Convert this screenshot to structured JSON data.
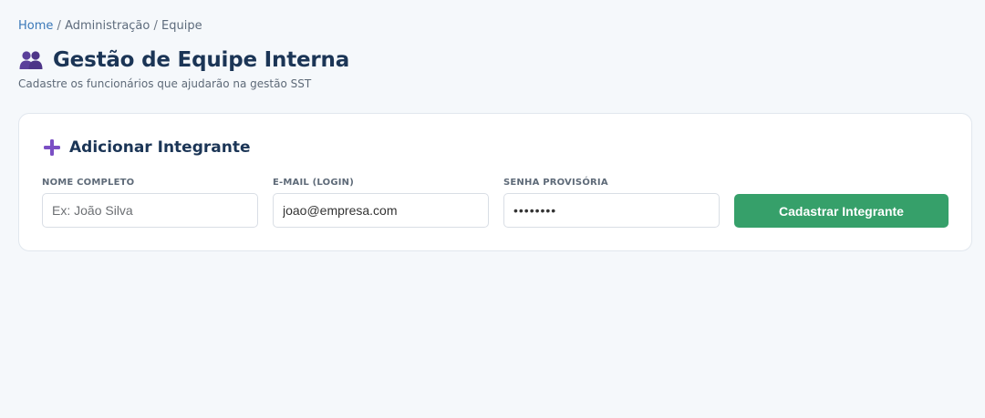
{
  "breadcrumb": {
    "home": "Home",
    "separator": "/",
    "level2": "Administração",
    "level3": "Equipe"
  },
  "header": {
    "icon": "team-icon",
    "title": "Gestão de Equipe Interna",
    "subtitle": "Cadastre os funcionários que ajudarão na gestão SST"
  },
  "card": {
    "icon": "plus-icon",
    "title": "Adicionar Integrante",
    "fields": {
      "name": {
        "label": "NOME COMPLETO",
        "placeholder": "Ex: João Silva",
        "value": ""
      },
      "email": {
        "label": "E-MAIL (LOGIN)",
        "placeholder": "",
        "value": "joao@empresa.com"
      },
      "password": {
        "label": "SENHA PROVISÓRIA",
        "placeholder": "",
        "value": "12345678"
      }
    },
    "submit_label": "Cadastrar Integrante"
  },
  "colors": {
    "accent_purple": "#7b4fc4",
    "button_green": "#36a06a",
    "link_blue": "#3a78b8",
    "heading_navy": "#1b3556"
  }
}
